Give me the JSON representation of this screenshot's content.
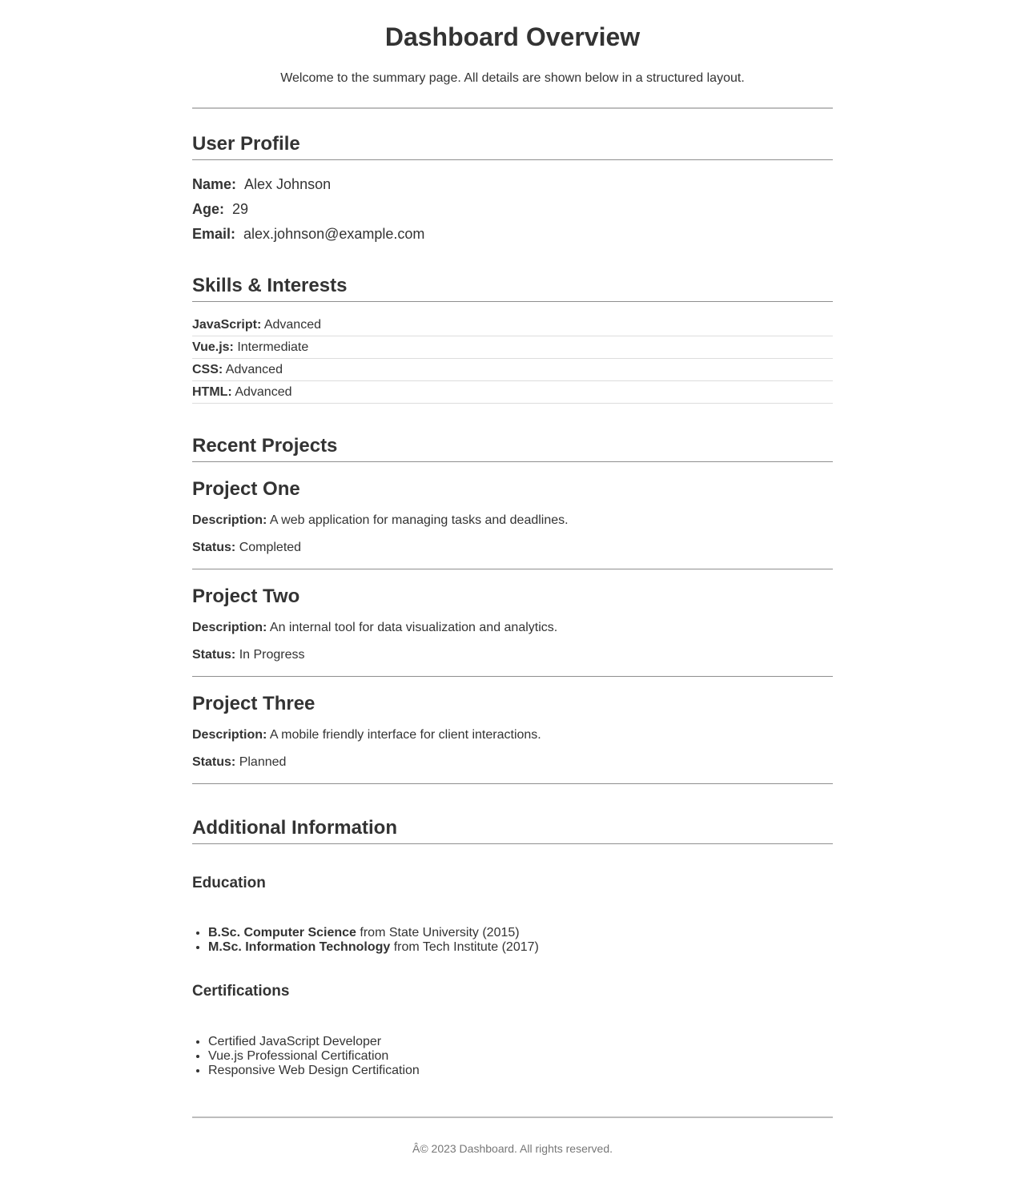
{
  "header": {
    "title": "Dashboard Overview",
    "subtitle": "Welcome to the summary page. All details are shown below in a structured layout."
  },
  "profile": {
    "title": "User Profile",
    "name_label": "Name:",
    "name": "Alex Johnson",
    "age_label": "Age:",
    "age": "29",
    "email_label": "Email:",
    "email": "alex.johnson@example.com"
  },
  "skills": {
    "title": "Skills & Interests",
    "items": [
      {
        "label": "JavaScript:",
        "value": "Advanced"
      },
      {
        "label": "Vue.js:",
        "value": "Intermediate"
      },
      {
        "label": "CSS:",
        "value": "Advanced"
      },
      {
        "label": "HTML:",
        "value": "Advanced"
      }
    ]
  },
  "projects": {
    "title": "Recent Projects",
    "description_label": "Description:",
    "status_label": "Status:",
    "items": [
      {
        "name": "Project One",
        "description": "A web application for managing tasks and deadlines.",
        "status": "Completed"
      },
      {
        "name": "Project Two",
        "description": "An internal tool for data visualization and analytics.",
        "status": "In Progress"
      },
      {
        "name": "Project Three",
        "description": "A mobile friendly interface for client interactions.",
        "status": "Planned"
      }
    ]
  },
  "additional": {
    "title": "Additional Information",
    "education": {
      "title": "Education",
      "items": [
        {
          "degree": "B.Sc. Computer Science",
          "detail": "from State University (2015)"
        },
        {
          "degree": "M.Sc. Information Technology",
          "detail": "from Tech Institute (2017)"
        }
      ]
    },
    "certifications": {
      "title": "Certifications",
      "items": [
        "Certified JavaScript Developer",
        "Vue.js Professional Certification",
        "Responsive Web Design Certification"
      ]
    }
  },
  "footer": {
    "text": "Â© 2023 Dashboard. All rights reserved."
  }
}
